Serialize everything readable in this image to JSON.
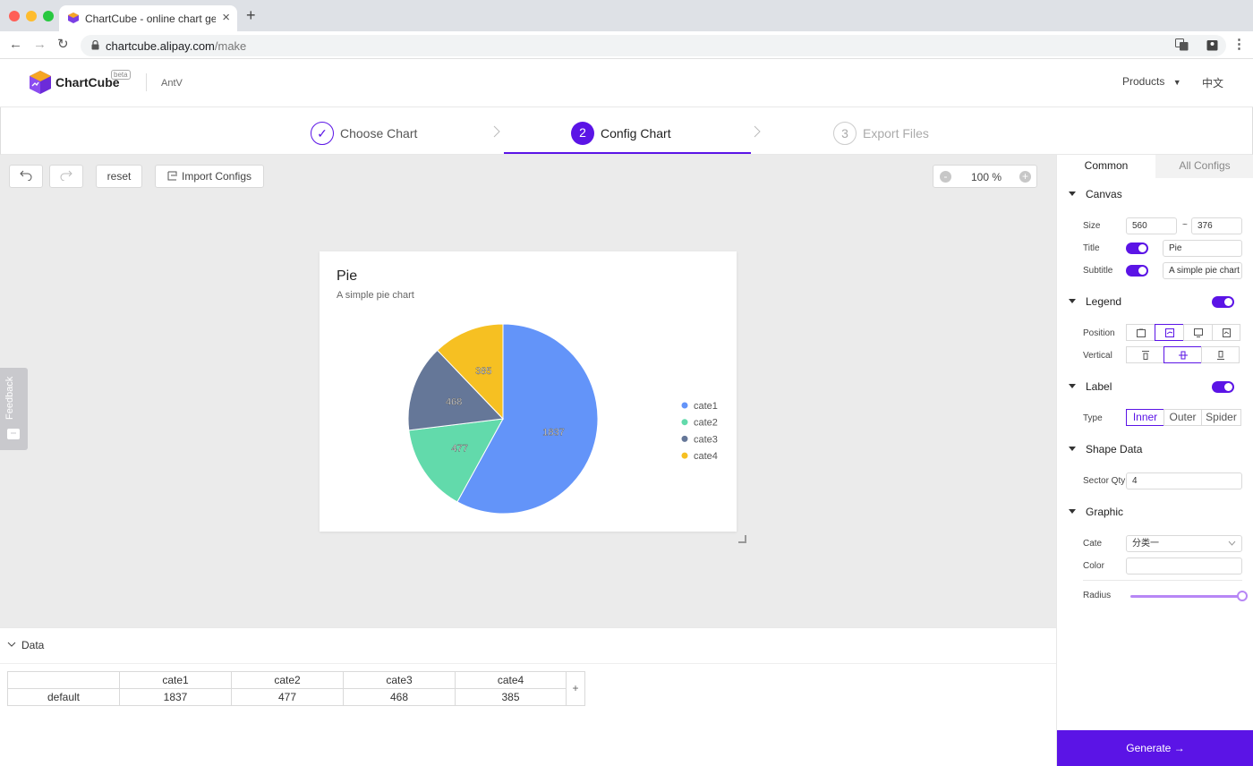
{
  "browser": {
    "tab_title": "ChartCube - online chart generator",
    "url_host": "chartcube.alipay.com",
    "url_path": "/make"
  },
  "header": {
    "brand": "ChartCube",
    "beta": "beta",
    "org": "AntV",
    "products": "Products",
    "lang": "中文"
  },
  "steps": [
    {
      "num": "✓",
      "label": "Choose Chart",
      "state": "done"
    },
    {
      "num": "2",
      "label": "Config Chart",
      "state": "active"
    },
    {
      "num": "3",
      "label": "Export Files",
      "state": "pending"
    }
  ],
  "toolbar": {
    "reset": "reset",
    "import": "Import Configs",
    "zoom": "100 %"
  },
  "feedback": "Feedback",
  "chart": {
    "title": "Pie",
    "subtitle": "A simple pie chart"
  },
  "chart_data": {
    "type": "pie",
    "title": "Pie",
    "subtitle": "A simple pie chart",
    "categories": [
      "cate1",
      "cate2",
      "cate3",
      "cate4"
    ],
    "values": [
      1837,
      477,
      468,
      385
    ],
    "colors": [
      "#6394f9",
      "#62daab",
      "#657798",
      "#f6c022"
    ],
    "legend": "right",
    "label_type": "inner"
  },
  "data_panel": {
    "title": "Data",
    "headers": [
      "",
      "cate1",
      "cate2",
      "cate3",
      "cate4"
    ],
    "row": [
      "default",
      "1837",
      "477",
      "468",
      "385"
    ],
    "add": "+"
  },
  "config": {
    "tabs": [
      "Common",
      "All Configs"
    ],
    "canvas": {
      "section": "Canvas",
      "size_label": "Size",
      "width": "560",
      "sep": "~",
      "height": "376",
      "title_label": "Title",
      "title_value": "Pie",
      "subtitle_label": "Subtitle",
      "subtitle_value": "A simple pie chart"
    },
    "legend": {
      "section": "Legend",
      "position_label": "Position",
      "vertical_label": "Vertical"
    },
    "label": {
      "section": "Label",
      "type_label": "Type",
      "types": [
        "Inner",
        "Outer",
        "Spider"
      ]
    },
    "shape": {
      "section": "Shape Data",
      "qty_label": "Sector Qty",
      "qty": "4"
    },
    "graphic": {
      "section": "Graphic",
      "cate_label": "Cate",
      "cate_value": "分类一",
      "color_label": "Color",
      "radius_label": "Radius",
      "radius_level": 1.0
    },
    "generate": "Generate"
  }
}
